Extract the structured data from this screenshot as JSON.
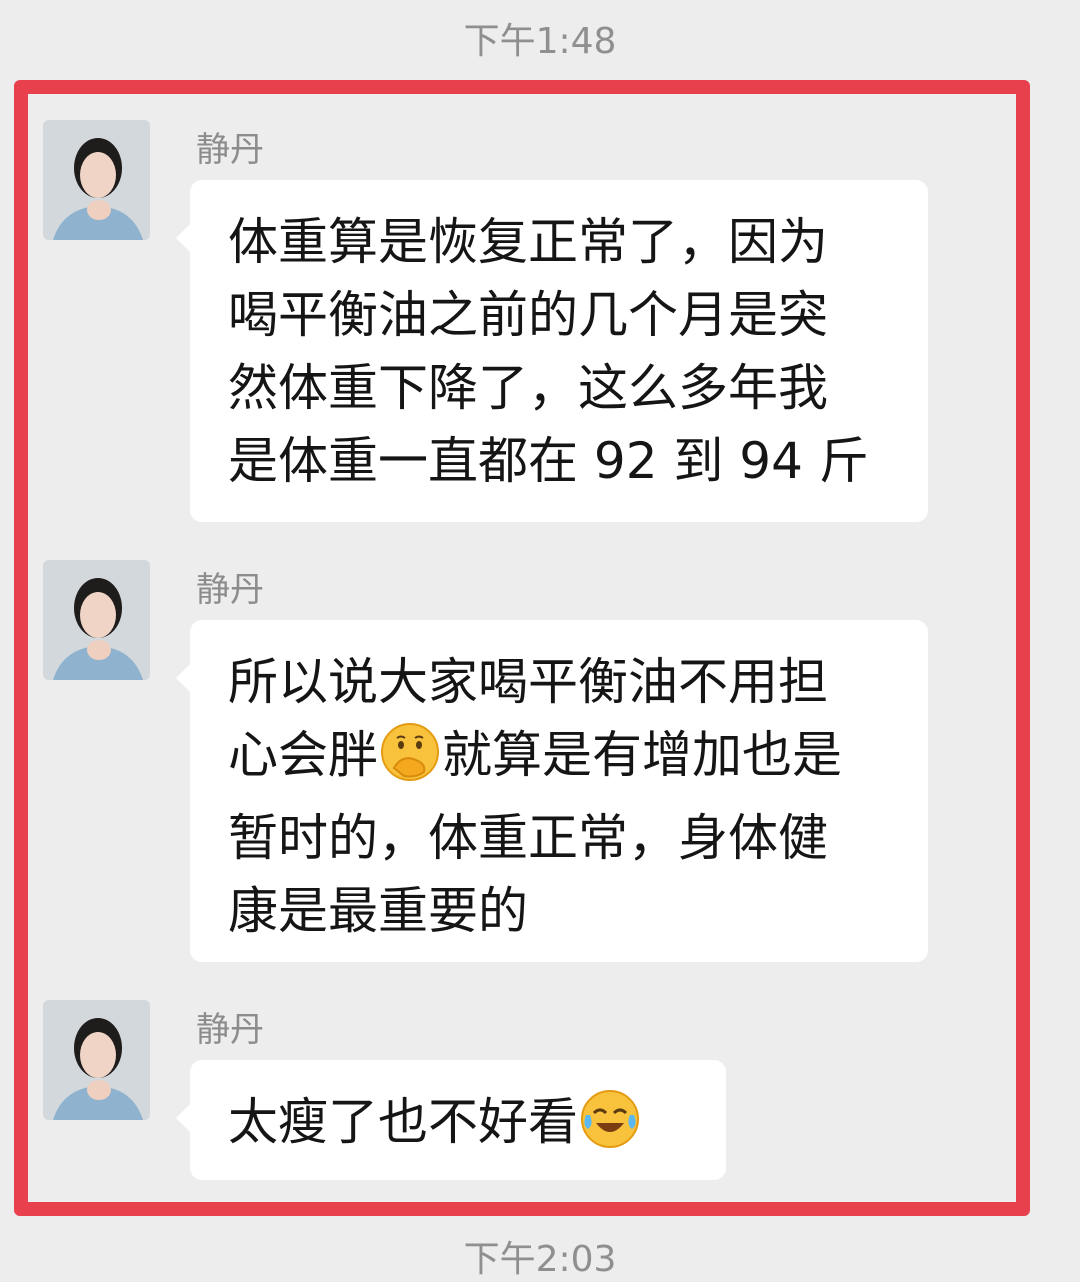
{
  "timestamps": {
    "top": "下午1:48",
    "bottom": "下午2:03"
  },
  "colors": {
    "highlight": "#e8414d",
    "background": "#ededed",
    "bubble": "#ffffff"
  },
  "messages": [
    {
      "sender": "静丹",
      "lines": [
        "体重算是恢复正常了，因为",
        "喝平衡油之前的几个月是突",
        "然体重下降了，这么多年我",
        "是体重一直都在 92 到 94 斤"
      ]
    },
    {
      "sender": "静丹",
      "lines": [
        "所以说大家喝平衡油不用担",
        "心会胖",
        "就算是有增加也是",
        "暂时的，体重正常，身体健",
        "康是最重要的"
      ],
      "emoji": "thinking-face-icon"
    },
    {
      "sender": "静丹",
      "lines": [
        "太瘦了也不好看"
      ],
      "emoji": "crying-laughing-face-icon"
    }
  ]
}
